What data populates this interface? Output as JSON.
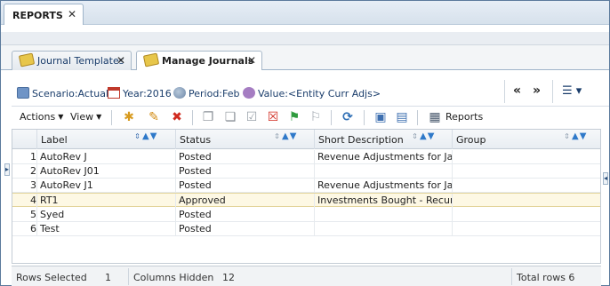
{
  "top_tab": {
    "label": "REPORTS",
    "close": "✕"
  },
  "inner_tabs": [
    {
      "label": "Journal Templates",
      "close": "✕"
    },
    {
      "label": "Manage Journals",
      "close": "✕"
    }
  ],
  "pov": {
    "scenario": "Scenario:Actual",
    "year": "Year:2016",
    "period": "Period:Feb",
    "value": "Value:<Entity Curr Adjs>",
    "nav_prev": "«",
    "nav_next": "»",
    "menu": "☰ ▾"
  },
  "toolbar": {
    "actions": "Actions",
    "view": "View",
    "reports": "Reports",
    "icons": [
      "new-journal-icon",
      "edit-pencil-icon",
      "delete-x-icon",
      "copy-icon",
      "paste-icon",
      "approve-check-icon",
      "reject-x-icon",
      "post-flag-icon",
      "unpost-flag-icon",
      "refresh-icon",
      "report-window-icon",
      "report-export-icon",
      "reports-icon"
    ]
  },
  "grid": {
    "columns": [
      "Label",
      "Status",
      "Short Description",
      "Group"
    ],
    "rows": [
      {
        "n": "1",
        "label": "AutoRev J",
        "status": "Posted",
        "desc": "Revenue Adjustments for Jan -",
        "group": ""
      },
      {
        "n": "2",
        "label": "AutoRev J01",
        "status": "Posted",
        "desc": "",
        "group": ""
      },
      {
        "n": "3",
        "label": "AutoRev J1",
        "status": "Posted",
        "desc": "Revenue Adjustments for Jan -",
        "group": ""
      },
      {
        "n": "4",
        "label": "RT1",
        "status": "Approved",
        "desc": "Investments Bought - Recurring",
        "group": ""
      },
      {
        "n": "5",
        "label": "Syed",
        "status": "Posted",
        "desc": "",
        "group": ""
      },
      {
        "n": "6",
        "label": "Test",
        "status": "Posted",
        "desc": "",
        "group": ""
      }
    ],
    "selected_row": "4"
  },
  "status_bar": {
    "rows_selected_label": "Rows Selected",
    "rows_selected_value": "1",
    "columns_hidden_label": "Columns Hidden",
    "columns_hidden_value": "12",
    "total_rows": "Total rows 6"
  },
  "colors": {
    "accent": "#1a3d6b",
    "selected_row_bg": "#fdf8e4",
    "sort_arrow": "#2f79c9"
  }
}
